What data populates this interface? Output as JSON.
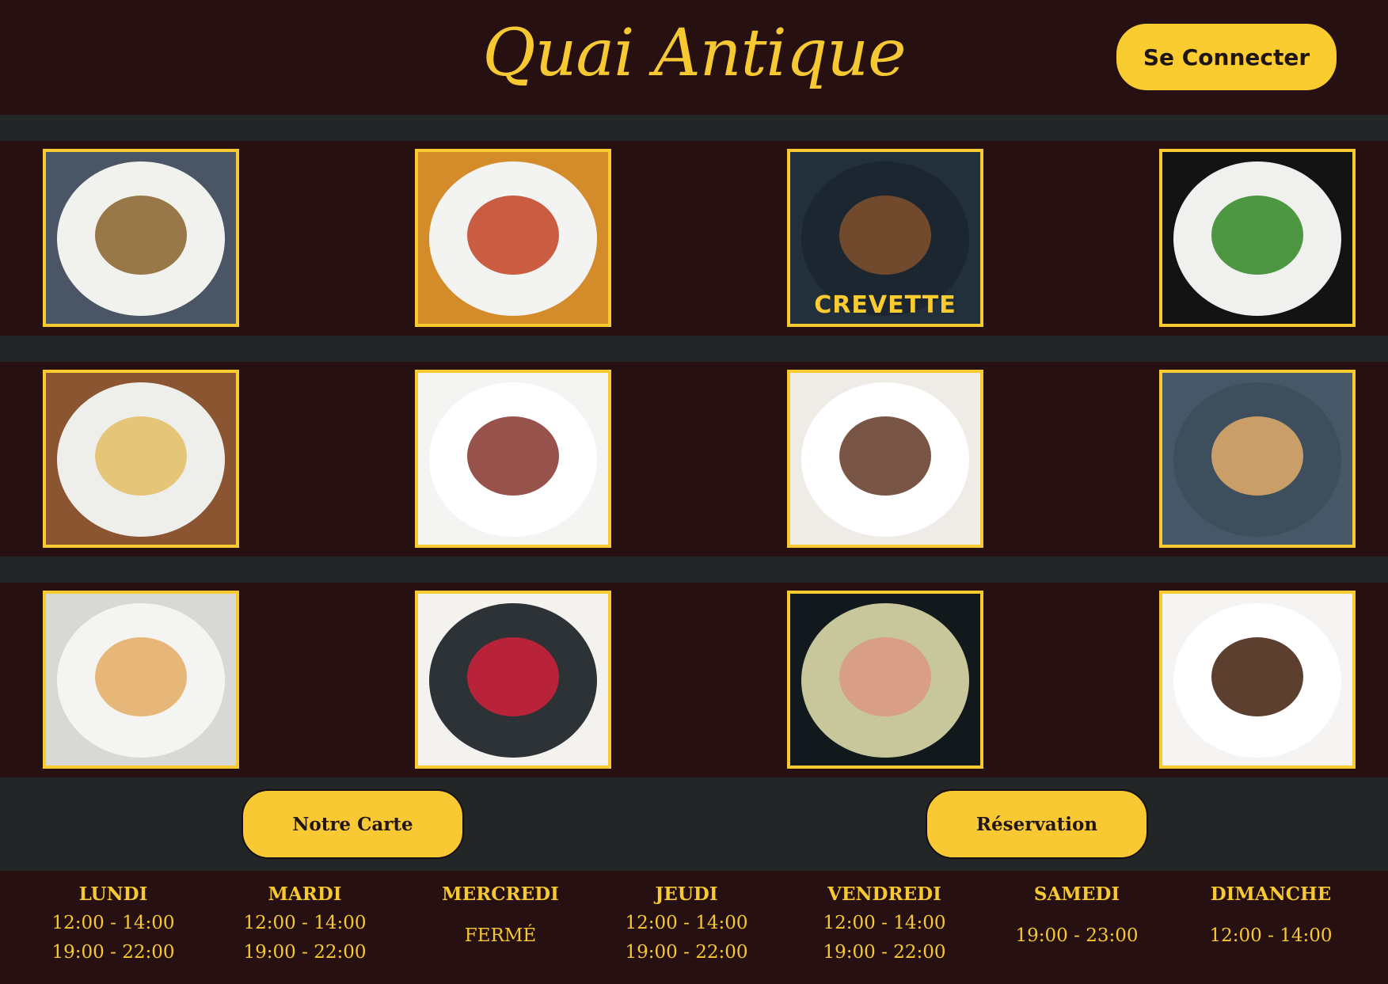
{
  "header": {
    "logo": "Quai Antique",
    "login_label": "Se Connecter"
  },
  "gallery": [
    [
      {
        "name": "brunch-dish",
        "label": "",
        "bg": "#4a5566",
        "plate": "#f1f1ee",
        "food": "#8e6a35"
      },
      {
        "name": "slate-plated-dish",
        "label": "",
        "bg": "#d48b2a",
        "plate": "#f3f3f2",
        "food": "#c44b2e"
      },
      {
        "name": "shrimp-skewers",
        "label": "CREVETTE",
        "bg": "#22303b",
        "plate": "#1b2630",
        "food": "#7b4f2d"
      },
      {
        "name": "greek-salad",
        "label": "",
        "bg": "#131313",
        "plate": "#f0f0ee",
        "food": "#3b8c2f"
      }
    ],
    [
      {
        "name": "pasta-penne",
        "label": "",
        "bg": "#8a5530",
        "plate": "#eeeeea",
        "food": "#e3c16c"
      },
      {
        "name": "sliced-duck",
        "label": "",
        "bg": "#f4f4f2",
        "plate": "#ffffff",
        "food": "#8d3f38"
      },
      {
        "name": "rack-of-lamb",
        "label": "",
        "bg": "#efebe6",
        "plate": "#ffffff",
        "food": "#6a4332"
      },
      {
        "name": "shrimp-spaghetti",
        "label": "",
        "bg": "#465867",
        "plate": "#3d4f5d",
        "food": "#d9a66a"
      }
    ],
    [
      {
        "name": "pancakes",
        "label": "",
        "bg": "#d8d8d4",
        "plate": "#f4f4f2",
        "food": "#e4b06a"
      },
      {
        "name": "fruit-tart",
        "label": "",
        "bg": "#f4f2ef",
        "plate": "#2d3236",
        "food": "#c8213a"
      },
      {
        "name": "macarons",
        "label": "",
        "bg": "#12191c",
        "plate": "#c8c79c",
        "food": "#d99a84"
      },
      {
        "name": "chocolate-brownie",
        "label": "",
        "bg": "#f6f4f2",
        "plate": "#ffffff",
        "food": "#4b2a1a"
      }
    ]
  ],
  "actions": {
    "menu_label": "Notre Carte",
    "reservation_label": "Réservation"
  },
  "hours": [
    {
      "day": "LUNDI",
      "lines": [
        "12:00 - 14:00",
        "19:00 - 22:00"
      ]
    },
    {
      "day": "MARDI",
      "lines": [
        "12:00 - 14:00",
        "19:00 - 22:00"
      ]
    },
    {
      "day": "MERCREDI",
      "lines": [
        "FERMÉ"
      ]
    },
    {
      "day": "JEUDI",
      "lines": [
        "12:00 - 14:00",
        "19:00 - 22:00"
      ]
    },
    {
      "day": "VENDREDI",
      "lines": [
        "12:00 - 14:00",
        "19:00 - 22:00"
      ]
    },
    {
      "day": "SAMEDI",
      "lines": [
        "19:00 - 23:00"
      ]
    },
    {
      "day": "DIMANCHE",
      "lines": [
        "12:00 - 14:00"
      ]
    }
  ],
  "colors": {
    "background": "#261011",
    "band": "#222626",
    "accent": "#fbcc30",
    "text_dark": "#1e1412"
  }
}
